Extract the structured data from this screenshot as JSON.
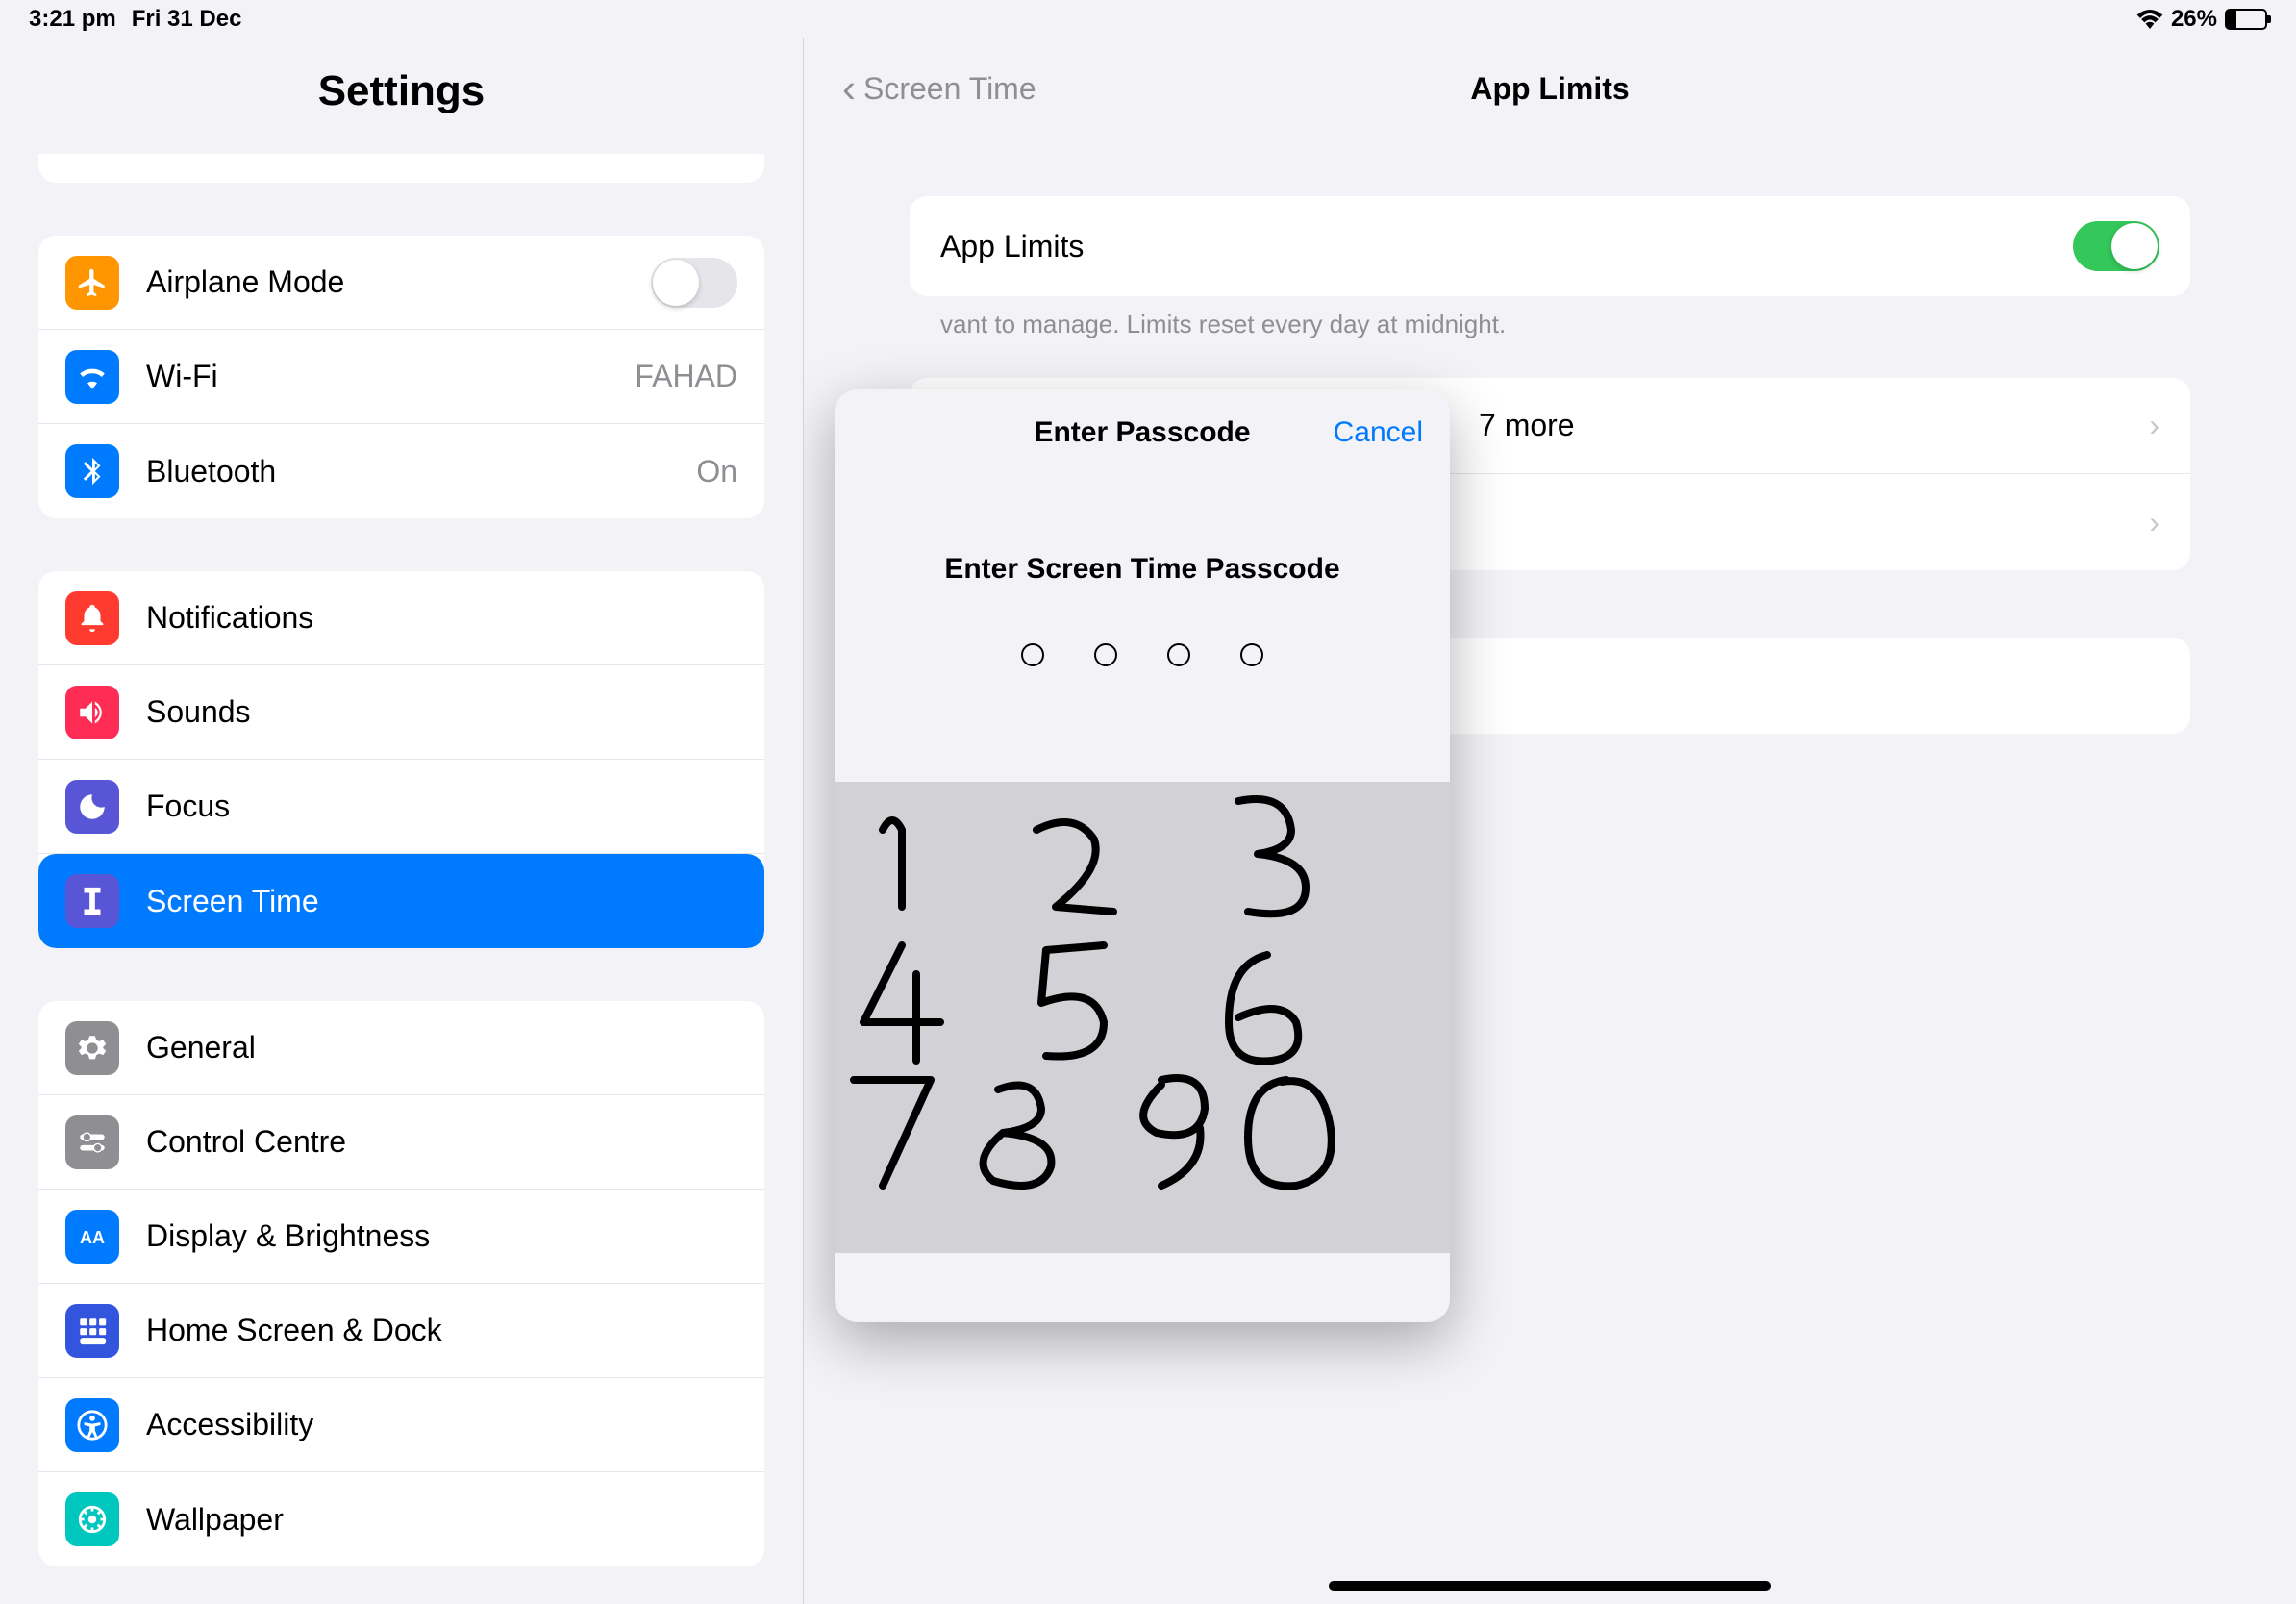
{
  "status_bar": {
    "time": "3:21 pm",
    "date": "Fri 31 Dec",
    "battery_percent": "26%"
  },
  "sidebar": {
    "title": "Settings",
    "groups": [
      {
        "items": [
          {
            "icon": "airplane",
            "label": "Airplane Mode",
            "type": "toggle",
            "value": ""
          },
          {
            "icon": "wifi",
            "label": "Wi-Fi",
            "type": "value",
            "value": "FAHAD"
          },
          {
            "icon": "bluetooth",
            "label": "Bluetooth",
            "type": "value",
            "value": "On"
          }
        ]
      },
      {
        "items": [
          {
            "icon": "notifications",
            "label": "Notifications"
          },
          {
            "icon": "sounds",
            "label": "Sounds"
          },
          {
            "icon": "focus",
            "label": "Focus"
          },
          {
            "icon": "screentime",
            "label": "Screen Time",
            "selected": true
          }
        ]
      },
      {
        "items": [
          {
            "icon": "general",
            "label": "General"
          },
          {
            "icon": "controlcentre",
            "label": "Control Centre"
          },
          {
            "icon": "display",
            "label": "Display & Brightness"
          },
          {
            "icon": "homescreen",
            "label": "Home Screen & Dock"
          },
          {
            "icon": "accessibility",
            "label": "Accessibility"
          },
          {
            "icon": "wallpaper",
            "label": "Wallpaper"
          }
        ]
      }
    ]
  },
  "detail": {
    "back_label": "Screen Time",
    "title": "App Limits",
    "row1_label": "App Limits",
    "footer_text": "vant to manage. Limits reset every day at midnight.",
    "row_partial": "7 more"
  },
  "popup": {
    "title": "Enter Passcode",
    "cancel": "Cancel",
    "prompt": "Enter Screen Time Passcode"
  },
  "icon_colors": {
    "airplane": "#ff9500",
    "wifi": "#007aff",
    "bluetooth": "#007aff",
    "notifications": "#ff3b30",
    "sounds": "#ff2d55",
    "focus": "#5856d6",
    "screentime": "#5856d6",
    "general": "#8e8e93",
    "controlcentre": "#8e8e93",
    "display": "#007aff",
    "homescreen": "#3355dd",
    "accessibility": "#007aff",
    "wallpaper": "#00c7be"
  }
}
